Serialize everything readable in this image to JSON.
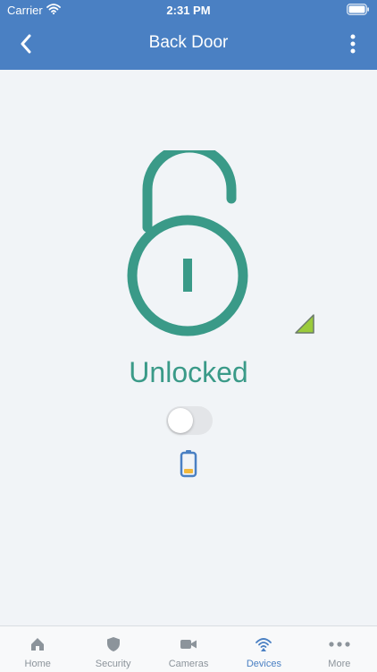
{
  "status_bar": {
    "carrier": "Carrier",
    "time": "2:31 PM"
  },
  "header": {
    "title": "Back Door",
    "back_icon": "chevron-left-icon",
    "more_icon": "vertical-ellipsis-icon"
  },
  "lock": {
    "state_label": "Unlocked",
    "toggle_on": false,
    "battery_level": 0.25,
    "colors": {
      "lock": "#3a9a88",
      "header": "#4a80c3",
      "battery_frame": "#4a80c3",
      "battery_fill": "#f2b83b",
      "signal": "#9bcb3b"
    }
  },
  "tabs": [
    {
      "label": "Home",
      "icon": "house-icon",
      "active": false
    },
    {
      "label": "Security",
      "icon": "shield-icon",
      "active": false
    },
    {
      "label": "Cameras",
      "icon": "video-camera-icon",
      "active": false
    },
    {
      "label": "Devices",
      "icon": "wifi-signal-icon",
      "active": true
    },
    {
      "label": "More",
      "icon": "horizontal-ellipsis-icon",
      "active": false
    }
  ]
}
